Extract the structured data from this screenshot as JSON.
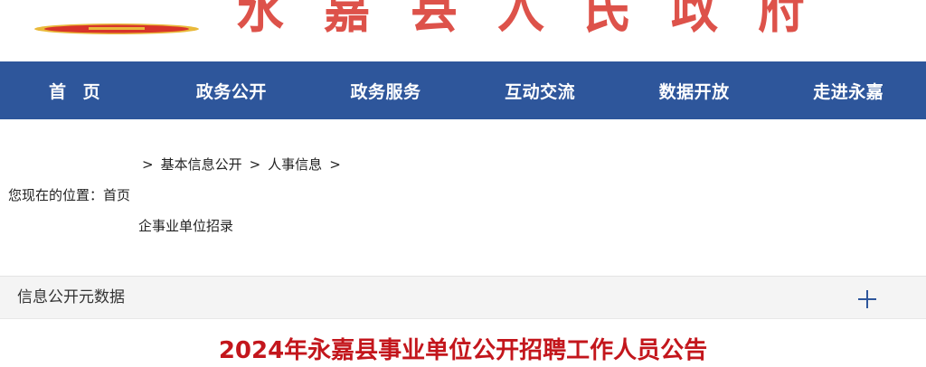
{
  "header": {
    "site_title": "永嘉县人民政府",
    "colors": {
      "emblem_red": "#d8342b",
      "emblem_gold": "#e9b93a"
    }
  },
  "nav": {
    "background": "#2e569b",
    "items": [
      {
        "label": "首 页"
      },
      {
        "label": "政务公开"
      },
      {
        "label": "政务服务"
      },
      {
        "label": "互动交流"
      },
      {
        "label": "数据开放"
      },
      {
        "label": "走进永嘉"
      }
    ]
  },
  "breadcrumb": {
    "prefix": "您现在的位置：",
    "separator": ">",
    "items": [
      {
        "label": "首页"
      },
      {
        "label": "基本信息公开"
      },
      {
        "label": "人事信息"
      },
      {
        "label": "企事业单位招录"
      }
    ]
  },
  "meta_panel": {
    "label": "信息公开元数据",
    "expand_icon": "plus-icon"
  },
  "article": {
    "title": "2024年永嘉县事业单位公开招聘工作人员公告",
    "title_color": "#c3161c"
  }
}
